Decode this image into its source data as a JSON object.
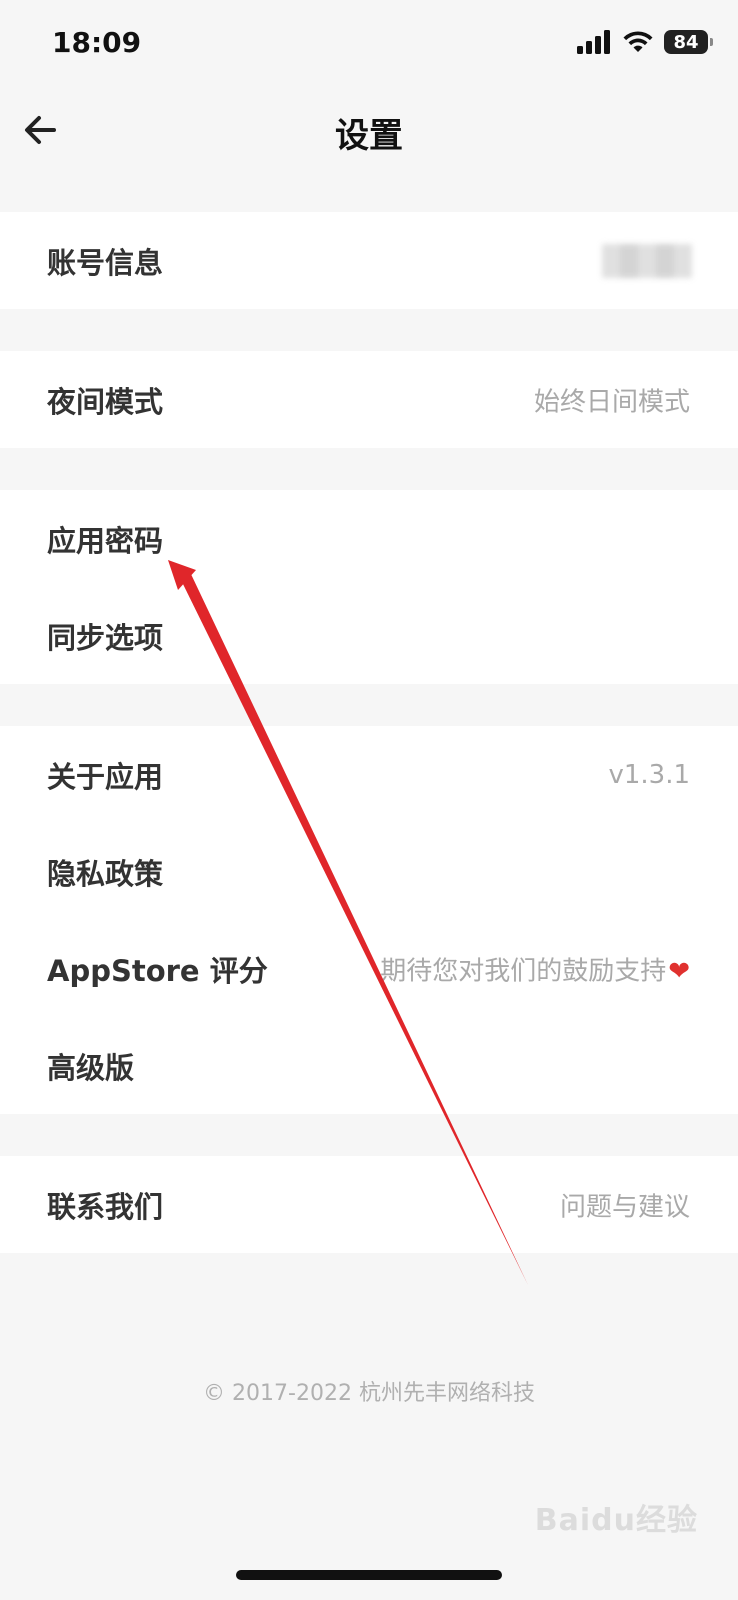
{
  "status_bar": {
    "time": "18:09",
    "battery": "84",
    "icons": [
      "signal-icon",
      "wifi-icon",
      "battery-icon"
    ]
  },
  "nav": {
    "title": "设置",
    "back_icon": "back-arrow-icon"
  },
  "groups": [
    {
      "rows": [
        {
          "label": "账号信息",
          "value": ""
        }
      ]
    },
    {
      "rows": [
        {
          "label": "夜间模式",
          "value": "始终日间模式"
        }
      ]
    },
    {
      "rows": [
        {
          "label": "应用密码",
          "value": ""
        },
        {
          "label": "同步选项",
          "value": ""
        }
      ]
    },
    {
      "rows": [
        {
          "label": "关于应用",
          "value": "v1.3.1"
        },
        {
          "label": "隐私政策",
          "value": ""
        },
        {
          "label": "AppStore 评分",
          "value": "期待您对我们的鼓励支持",
          "value_icon": "heart-icon"
        },
        {
          "label": "高级版",
          "value": ""
        }
      ]
    },
    {
      "rows": [
        {
          "label": "联系我们",
          "value": "问题与建议"
        }
      ]
    }
  ],
  "footer": {
    "copyright": "© 2017-2022 杭州先丰网络科技"
  },
  "watermark": "Baidu经验",
  "colors": {
    "background": "#f6f6f6",
    "card": "#ffffff",
    "annotation_arrow": "#e0262a",
    "heart": "#e0312f"
  }
}
